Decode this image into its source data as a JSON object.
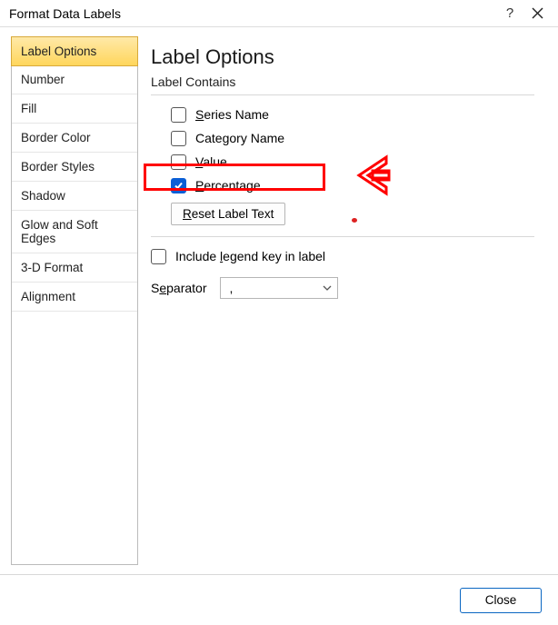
{
  "titlebar": {
    "title": "Format Data Labels",
    "help": "?"
  },
  "sidebar": {
    "items": [
      {
        "label": "Label Options"
      },
      {
        "label": "Number"
      },
      {
        "label": "Fill"
      },
      {
        "label": "Border Color"
      },
      {
        "label": "Border Styles"
      },
      {
        "label": "Shadow"
      },
      {
        "label": "Glow and Soft Edges"
      },
      {
        "label": "3-D Format"
      },
      {
        "label": "Alignment"
      }
    ]
  },
  "panel": {
    "heading": "Label Options",
    "contains_label": "Label Contains",
    "opts": {
      "series_pre": "",
      "series_u": "S",
      "series_post": "eries Name",
      "category_pre": "Cate",
      "category_u": "g",
      "category_post": "ory Name",
      "value_pre": "",
      "value_u": "V",
      "value_post": "alue",
      "percentage_pre": "",
      "percentage_u": "P",
      "percentage_post": "ercentage"
    },
    "reset_pre": "",
    "reset_u": "R",
    "reset_post": "eset Label Text",
    "legend_pre": "Include ",
    "legend_u": "l",
    "legend_post": "egend key in label",
    "separator_pre": "S",
    "separator_u": "e",
    "separator_post": "parator",
    "separator_value": ","
  },
  "footer": {
    "close": "Close"
  }
}
